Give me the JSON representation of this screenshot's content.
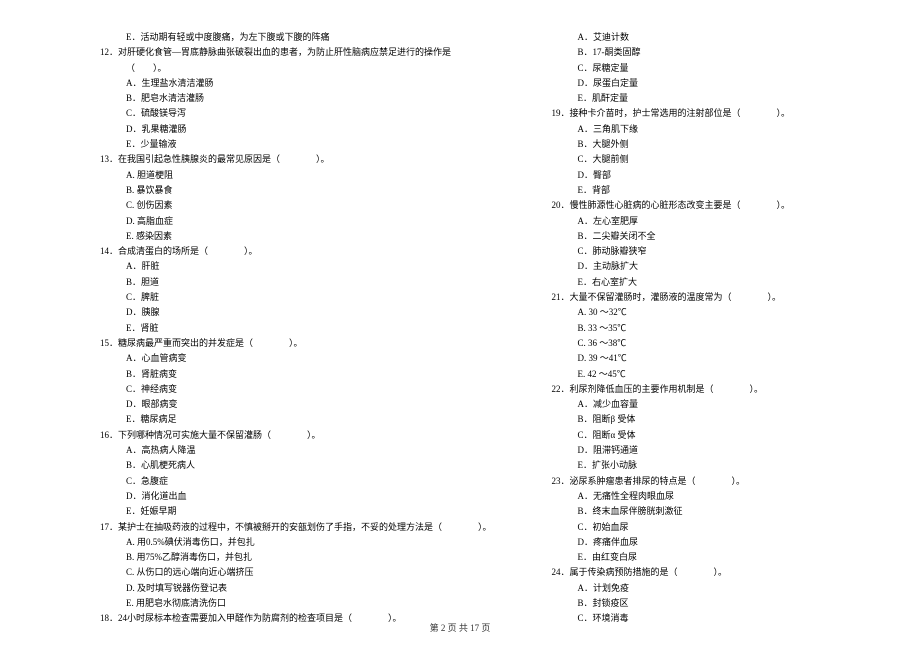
{
  "col1": [
    {
      "cls": "indent-2",
      "text": "E．活动期有轻或中度腹痛，为左下腹或下腹的阵痛"
    },
    {
      "cls": "",
      "text": "12．对肝硬化食管—胃底静脉曲张破裂出血的患者，为防止肝性脑病应禁足进行的操作是"
    },
    {
      "cls": "indent-1",
      "text": "（　　）。"
    },
    {
      "cls": "indent-2",
      "text": "A．生理盐水清洁灌肠"
    },
    {
      "cls": "indent-2",
      "text": "B．肥皂水清洁灌肠"
    },
    {
      "cls": "indent-2",
      "text": "C．硫酸镁导泻"
    },
    {
      "cls": "indent-2",
      "text": "D．乳果糖灌肠"
    },
    {
      "cls": "indent-2",
      "text": "E．少量输液"
    },
    {
      "cls": "",
      "text": "13．在我国引起急性胰腺炎的最常见原因是（　　　　）。"
    },
    {
      "cls": "indent-2",
      "text": "A. 胆道梗阻"
    },
    {
      "cls": "indent-2",
      "text": "B. 暴饮暴食"
    },
    {
      "cls": "indent-2",
      "text": "C. 创伤因素"
    },
    {
      "cls": "indent-2",
      "text": "D. 高脂血症"
    },
    {
      "cls": "indent-2",
      "text": "E. 感染因素"
    },
    {
      "cls": "",
      "text": "14．合成清蛋白的场所是（　　　　）。"
    },
    {
      "cls": "indent-2",
      "text": "A．肝脏"
    },
    {
      "cls": "indent-2",
      "text": "B．胆道"
    },
    {
      "cls": "indent-2",
      "text": "C．脾脏"
    },
    {
      "cls": "indent-2",
      "text": "D．胰腺"
    },
    {
      "cls": "indent-2",
      "text": "E．肾脏"
    },
    {
      "cls": "",
      "text": "15．糖尿病最严重而突出的并发症是（　　　　）。"
    },
    {
      "cls": "indent-2",
      "text": "A．心血管病变"
    },
    {
      "cls": "indent-2",
      "text": "B．肾脏病变"
    },
    {
      "cls": "indent-2",
      "text": "C．神经病变"
    },
    {
      "cls": "indent-2",
      "text": "D．眼部病变"
    },
    {
      "cls": "indent-2",
      "text": "E．糖尿病足"
    },
    {
      "cls": "",
      "text": "16．下列哪种情况可实施大量不保留灌肠（　　　　）。"
    },
    {
      "cls": "indent-2",
      "text": "A．高热病人降温"
    },
    {
      "cls": "indent-2",
      "text": "B．心肌梗死病人"
    },
    {
      "cls": "indent-2",
      "text": "C．急腹症"
    },
    {
      "cls": "indent-2",
      "text": "D．消化道出血"
    },
    {
      "cls": "indent-2",
      "text": "E．妊娠早期"
    },
    {
      "cls": "",
      "text": "17．某护士在抽吸药液的过程中，不慎被掰开的安瓿划伤了手指，不妥的处理方法是（　　　　）。"
    },
    {
      "cls": "indent-2",
      "text": "A. 用0.5%碘伏消毒伤口，并包扎"
    },
    {
      "cls": "indent-2",
      "text": "B. 用75%乙醇消毒伤口，并包扎"
    },
    {
      "cls": "indent-2",
      "text": "C. 从伤口的远心端向近心端挤压"
    },
    {
      "cls": "indent-2",
      "text": "D. 及时填写锐器伤登记表"
    },
    {
      "cls": "indent-2",
      "text": "E. 用肥皂水彻底清洗伤口"
    },
    {
      "cls": "",
      "text": "18．24小时尿标本检查需要加入甲醛作为防腐剂的检查项目是（　　　　）。"
    }
  ],
  "col2": [
    {
      "cls": "indent-2",
      "text": "A．艾迪计数"
    },
    {
      "cls": "indent-2",
      "text": "B．17-酮类固醇"
    },
    {
      "cls": "indent-2",
      "text": "C．尿糖定量"
    },
    {
      "cls": "indent-2",
      "text": "D．尿蛋白定量"
    },
    {
      "cls": "indent-2",
      "text": "E．肌酐定量"
    },
    {
      "cls": "",
      "text": "19．接种卡介苗时，护士常选用的注射部位是（　　　　）。"
    },
    {
      "cls": "indent-2",
      "text": "A．三角肌下缘"
    },
    {
      "cls": "indent-2",
      "text": "B．大腿外侧"
    },
    {
      "cls": "indent-2",
      "text": "C．大腿前侧"
    },
    {
      "cls": "indent-2",
      "text": "D．臀部"
    },
    {
      "cls": "indent-2",
      "text": "E．背部"
    },
    {
      "cls": "",
      "text": "20．慢性肺源性心脏病的心脏形态改变主要是（　　　　）。"
    },
    {
      "cls": "indent-2",
      "text": "A．左心室肥厚"
    },
    {
      "cls": "indent-2",
      "text": "B．二尖瓣关闭不全"
    },
    {
      "cls": "indent-2",
      "text": "C．肺动脉瓣狭窄"
    },
    {
      "cls": "indent-2",
      "text": "D．主动脉扩大"
    },
    {
      "cls": "indent-2",
      "text": "E．右心室扩大"
    },
    {
      "cls": "",
      "text": "21．大量不保留灌肠时，灌肠液的温度常为（　　　　）。"
    },
    {
      "cls": "indent-2",
      "text": "A. 30 ～32℃"
    },
    {
      "cls": "indent-2",
      "text": "B. 33 ～35℃"
    },
    {
      "cls": "indent-2",
      "text": "C. 36 ～38℃"
    },
    {
      "cls": "indent-2",
      "text": "D. 39 ～41℃"
    },
    {
      "cls": "indent-2",
      "text": "E. 42 ～45℃"
    },
    {
      "cls": "",
      "text": "22．利尿剂降低血压的主要作用机制是（　　　　）。"
    },
    {
      "cls": "indent-2",
      "text": "A．减少血容量"
    },
    {
      "cls": "indent-2",
      "text": "B．阻断β 受体"
    },
    {
      "cls": "indent-2",
      "text": "C．阻断α 受体"
    },
    {
      "cls": "indent-2",
      "text": "D．阻滞钙通道"
    },
    {
      "cls": "indent-2",
      "text": "E．扩张小动脉"
    },
    {
      "cls": "",
      "text": "23．泌尿系肿瘤患者排尿的特点是（　　　　）。"
    },
    {
      "cls": "indent-2",
      "text": "A．无痛性全程肉眼血尿"
    },
    {
      "cls": "indent-2",
      "text": "B．终末血尿伴膀胱刺激征"
    },
    {
      "cls": "indent-2",
      "text": "C．初始血尿"
    },
    {
      "cls": "indent-2",
      "text": "D．疼痛伴血尿"
    },
    {
      "cls": "indent-2",
      "text": "E．由红变白尿"
    },
    {
      "cls": "",
      "text": "24．属于传染病预防措施的是（　　　　）。"
    },
    {
      "cls": "indent-2",
      "text": "A．计划免疫"
    },
    {
      "cls": "indent-2",
      "text": "B．封锁疫区"
    },
    {
      "cls": "indent-2",
      "text": "C．环境消毒"
    }
  ],
  "footer": "第 2 页 共 17 页"
}
